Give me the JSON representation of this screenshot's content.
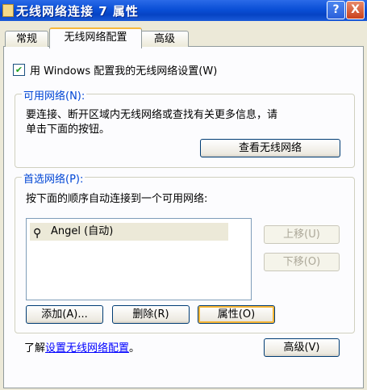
{
  "window": {
    "title": "无线网络连接 7 属性",
    "help_button": "?",
    "close_button": "X"
  },
  "tabs": [
    {
      "label": "常规"
    },
    {
      "label": "无线网络配置"
    },
    {
      "label": "高级"
    }
  ],
  "use_windows_checkbox": {
    "label": "用 Windows 配置我的无线网络设置(W)",
    "checked": true
  },
  "available_networks": {
    "title": "可用网络(N):",
    "description_line1": "要连接、断开区域内无线网络或查找有关更多信息，请",
    "description_line2": "单击下面的按钮。",
    "view_button": "查看无线网络"
  },
  "preferred_networks": {
    "title": "首选网络(P):",
    "description": "按下面的顺序自动连接到一个可用网络:",
    "items": [
      {
        "label": "Angel (自动)",
        "icon": "antenna-icon"
      }
    ],
    "move_up_button": "上移(U)",
    "move_down_button": "下移(O)",
    "add_button": "添加(A)...",
    "remove_button": "删除(R)",
    "properties_button": "属性(O)"
  },
  "footer": {
    "learn_prefix": "了解",
    "learn_link": "设置无线网络配置",
    "learn_suffix": "。",
    "advanced_button": "高级(V)"
  }
}
